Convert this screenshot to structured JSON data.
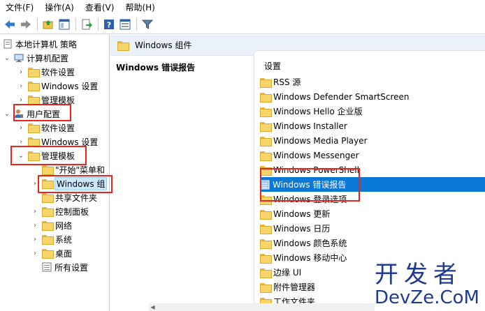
{
  "menu": {
    "file": "文件(F)",
    "action": "操作(A)",
    "view": "查看(V)",
    "help": "帮助(H)"
  },
  "toolbar": {
    "icons": [
      "back-icon",
      "forward-icon",
      "up-folder-icon",
      "show-hide-tree-icon",
      "export-icon",
      "help-icon",
      "properties-icon",
      "filter-icon"
    ]
  },
  "tree": {
    "root": "本地计算机 策略",
    "computer_config": "计算机配置",
    "computer_software": "软件设置",
    "computer_windows": "Windows 设置",
    "computer_admin": "管理模板",
    "user_config": "用户配置",
    "user_software": "软件设置",
    "user_windows": "Windows 设置",
    "user_admin": "管理模板",
    "start_menu": "\"开始\"菜单和",
    "windows_components": "Windows 组",
    "shared_folders": "共享文件夹",
    "control_panel": "控制面板",
    "network": "网络",
    "system": "系统",
    "desktop": "桌面",
    "all_settings": "所有设置"
  },
  "header": {
    "title": "Windows 组件"
  },
  "description": {
    "title": "Windows 错误报告"
  },
  "list": {
    "column": "设置",
    "items": [
      "RSS 源",
      "Windows Defender SmartScreen",
      "Windows Hello 企业版",
      "Windows Installer",
      "Windows Media Player",
      "Windows Messenger",
      "Windows PowerShell",
      "Windows 错误报告",
      "Windows 登录选项",
      "Windows 更新",
      "Windows 日历",
      "Windows 颜色系统",
      "Windows 移动中心",
      "边缘 UI",
      "附件管理器",
      "工作文件夹"
    ],
    "selected_index": 7
  },
  "watermark": {
    "line1": "开发者",
    "line2": "DevZe.CoM"
  },
  "colors": {
    "highlight_border": "#e8251f",
    "selection": "#0a78d7",
    "watermark": "#1f3b8f",
    "folder": "#f7d56b"
  }
}
